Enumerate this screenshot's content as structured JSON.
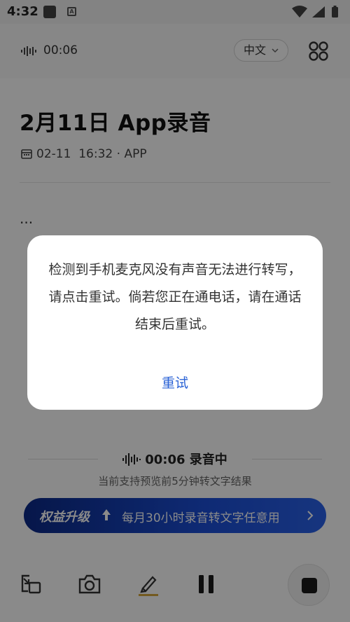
{
  "status_bar": {
    "time": "4:32",
    "notif_icon_letter": "A"
  },
  "header": {
    "timer": "00:06",
    "language": "中文"
  },
  "recording": {
    "title": "2月11日 App录音",
    "date": "02-11",
    "time": "16:32",
    "source": "APP",
    "content": "..."
  },
  "status": {
    "timer": "00:06",
    "state": "录音中",
    "hint": "当前支持预览前5分钟转文字结果"
  },
  "banner": {
    "title": "权益升级",
    "text": "每月30小时录音转文字任意用",
    "accent": "#1c4fd8"
  },
  "dialog": {
    "message": "检测到手机麦克风没有声音无法进行转写，请点击重试。倘若您正在通电话，请在通话结束后重试。",
    "retry_label": "重试",
    "button_color": "#2a62d6"
  },
  "toolbar": {
    "icons": [
      "picture-in-picture-icon",
      "camera-icon",
      "highlighter-icon",
      "pause-icon",
      "stop-icon"
    ]
  }
}
